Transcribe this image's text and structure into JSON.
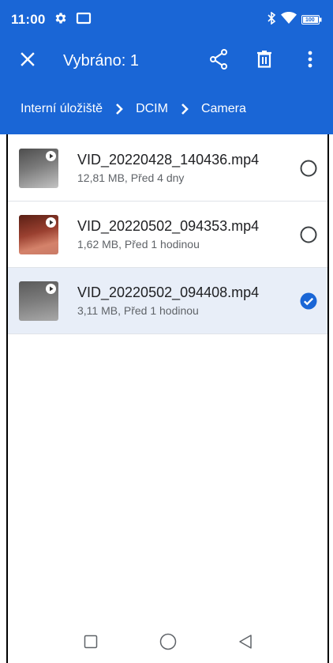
{
  "status_bar": {
    "time": "11:00",
    "battery": "100",
    "icons": [
      "gear-icon",
      "screen-cast-icon",
      "bluetooth-icon",
      "wifi-icon",
      "battery-icon"
    ]
  },
  "app_bar": {
    "title": "Vybráno: 1",
    "icons": [
      "close-icon",
      "share-icon",
      "delete-icon",
      "more-vert-icon"
    ]
  },
  "breadcrumb": [
    "Interní úložiště",
    "DCIM",
    "Camera"
  ],
  "files": [
    {
      "name": "VID_20220428_140436.mp4",
      "meta": "12,81 MB, Před 4 dny",
      "selected": false
    },
    {
      "name": "VID_20220502_094353.mp4",
      "meta": "1,62 MB, Před 1 hodinou",
      "selected": false
    },
    {
      "name": "VID_20220502_094408.mp4",
      "meta": "3,11 MB, Před 1 hodinou",
      "selected": true
    }
  ],
  "nav_bar": {
    "icons": [
      "recents-icon",
      "home-icon",
      "back-icon"
    ]
  },
  "colors": {
    "primary": "#1a66d6",
    "selected_row": "#e8eef8",
    "check": "#1a66d6"
  }
}
